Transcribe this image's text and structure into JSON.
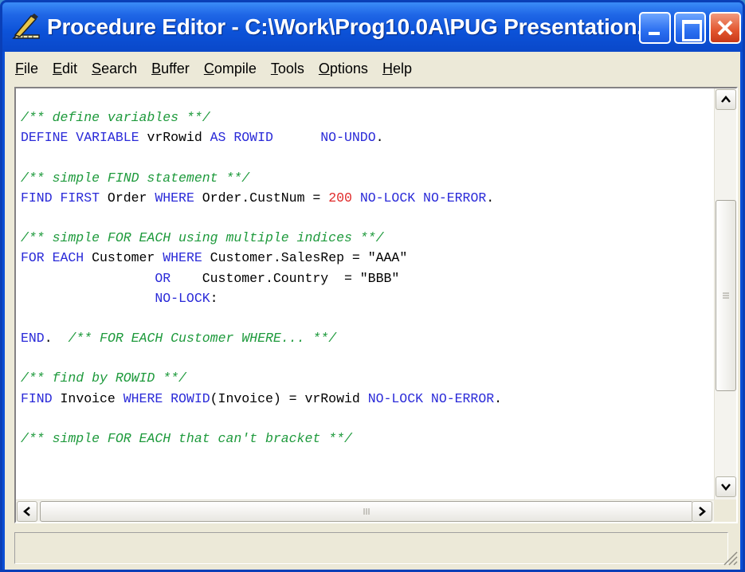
{
  "window": {
    "title": "Procedure Editor - C:\\Work\\Prog10.0A\\PUG Presentation...",
    "app_icon": "pencil-ruler-icon",
    "accent": "#0b4fd6",
    "close_color": "#e2552e"
  },
  "menu": {
    "items": [
      {
        "mn": "F",
        "rest": "ile"
      },
      {
        "mn": "E",
        "rest": "dit"
      },
      {
        "mn": "S",
        "rest": "earch"
      },
      {
        "mn": "B",
        "rest": "uffer"
      },
      {
        "mn": "C",
        "rest": "ompile"
      },
      {
        "mn": "T",
        "rest": "ools"
      },
      {
        "mn": "O",
        "rest": "ptions"
      },
      {
        "mn": "H",
        "rest": "elp"
      }
    ]
  },
  "editor": {
    "colors": {
      "keyword": "#2a2ad8",
      "comment": "#1e9a3c",
      "number": "#e02a2a",
      "identifier": "#000000"
    },
    "lines": [
      [
        [
          "cm",
          "/** define variables **/"
        ]
      ],
      [
        [
          "kw",
          "DEFINE VARIABLE "
        ],
        [
          "id",
          "vrRowid "
        ],
        [
          "kw",
          "AS ROWID      NO-UNDO"
        ],
        [
          "id",
          "."
        ]
      ],
      [],
      [
        [
          "cm",
          "/** simple FIND statement **/"
        ]
      ],
      [
        [
          "kw",
          "FIND FIRST "
        ],
        [
          "id",
          "Order "
        ],
        [
          "kw",
          "WHERE "
        ],
        [
          "id",
          "Order.CustNum = "
        ],
        [
          "num",
          "200"
        ],
        [
          "kw",
          " NO-LOCK NO-ERROR"
        ],
        [
          "id",
          "."
        ]
      ],
      [],
      [
        [
          "cm",
          "/** simple FOR EACH using multiple indices **/"
        ]
      ],
      [
        [
          "kw",
          "FOR EACH "
        ],
        [
          "id",
          "Customer "
        ],
        [
          "kw",
          "WHERE "
        ],
        [
          "id",
          "Customer.SalesRep = "
        ],
        [
          "str",
          "\"AAA\""
        ]
      ],
      [
        [
          "id",
          "                 "
        ],
        [
          "kw",
          "OR"
        ],
        [
          "id",
          "    Customer.Country  = "
        ],
        [
          "str",
          "\"BBB\""
        ]
      ],
      [
        [
          "id",
          "                 "
        ],
        [
          "kw",
          "NO-LOCK"
        ],
        [
          "id",
          ":"
        ]
      ],
      [],
      [
        [
          "kw",
          "END"
        ],
        [
          "id",
          ".  "
        ],
        [
          "cm",
          "/** FOR EACH Customer WHERE... **/"
        ]
      ],
      [],
      [
        [
          "cm",
          "/** find by ROWID **/"
        ]
      ],
      [
        [
          "kw",
          "FIND "
        ],
        [
          "id",
          "Invoice "
        ],
        [
          "kw",
          "WHERE ROWID"
        ],
        [
          "id",
          "(Invoice) = vrRowid "
        ],
        [
          "kw",
          "NO-LOCK NO-ERROR"
        ],
        [
          "id",
          "."
        ]
      ],
      [],
      [
        [
          "cm",
          "/** simple FOR EACH that can't bracket **/"
        ]
      ]
    ]
  },
  "status": {
    "text": ""
  }
}
